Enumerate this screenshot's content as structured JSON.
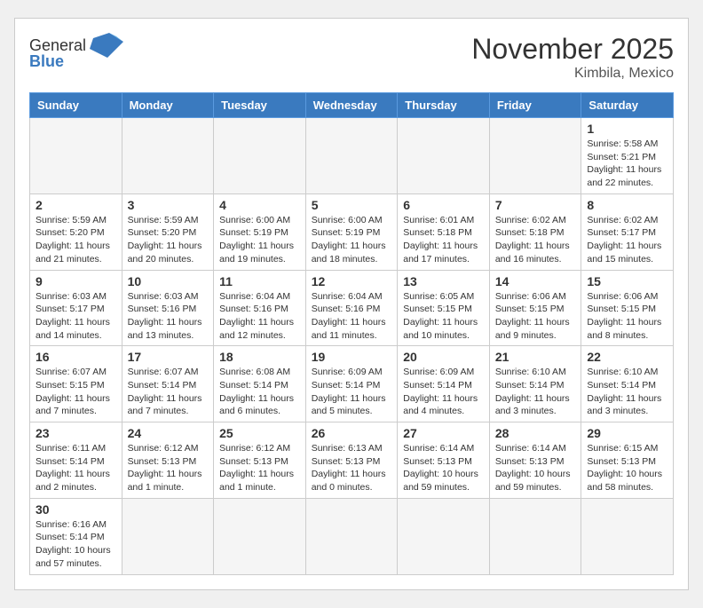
{
  "header": {
    "logo_general": "General",
    "logo_blue": "Blue",
    "title": "November 2025",
    "subtitle": "Kimbila, Mexico"
  },
  "days_of_week": [
    "Sunday",
    "Monday",
    "Tuesday",
    "Wednesday",
    "Thursday",
    "Friday",
    "Saturday"
  ],
  "weeks": [
    [
      {
        "day": "",
        "info": ""
      },
      {
        "day": "",
        "info": ""
      },
      {
        "day": "",
        "info": ""
      },
      {
        "day": "",
        "info": ""
      },
      {
        "day": "",
        "info": ""
      },
      {
        "day": "",
        "info": ""
      },
      {
        "day": "1",
        "info": "Sunrise: 5:58 AM\nSunset: 5:21 PM\nDaylight: 11 hours and 22 minutes."
      }
    ],
    [
      {
        "day": "2",
        "info": "Sunrise: 5:59 AM\nSunset: 5:20 PM\nDaylight: 11 hours and 21 minutes."
      },
      {
        "day": "3",
        "info": "Sunrise: 5:59 AM\nSunset: 5:20 PM\nDaylight: 11 hours and 20 minutes."
      },
      {
        "day": "4",
        "info": "Sunrise: 6:00 AM\nSunset: 5:19 PM\nDaylight: 11 hours and 19 minutes."
      },
      {
        "day": "5",
        "info": "Sunrise: 6:00 AM\nSunset: 5:19 PM\nDaylight: 11 hours and 18 minutes."
      },
      {
        "day": "6",
        "info": "Sunrise: 6:01 AM\nSunset: 5:18 PM\nDaylight: 11 hours and 17 minutes."
      },
      {
        "day": "7",
        "info": "Sunrise: 6:02 AM\nSunset: 5:18 PM\nDaylight: 11 hours and 16 minutes."
      },
      {
        "day": "8",
        "info": "Sunrise: 6:02 AM\nSunset: 5:17 PM\nDaylight: 11 hours and 15 minutes."
      }
    ],
    [
      {
        "day": "9",
        "info": "Sunrise: 6:03 AM\nSunset: 5:17 PM\nDaylight: 11 hours and 14 minutes."
      },
      {
        "day": "10",
        "info": "Sunrise: 6:03 AM\nSunset: 5:16 PM\nDaylight: 11 hours and 13 minutes."
      },
      {
        "day": "11",
        "info": "Sunrise: 6:04 AM\nSunset: 5:16 PM\nDaylight: 11 hours and 12 minutes."
      },
      {
        "day": "12",
        "info": "Sunrise: 6:04 AM\nSunset: 5:16 PM\nDaylight: 11 hours and 11 minutes."
      },
      {
        "day": "13",
        "info": "Sunrise: 6:05 AM\nSunset: 5:15 PM\nDaylight: 11 hours and 10 minutes."
      },
      {
        "day": "14",
        "info": "Sunrise: 6:06 AM\nSunset: 5:15 PM\nDaylight: 11 hours and 9 minutes."
      },
      {
        "day": "15",
        "info": "Sunrise: 6:06 AM\nSunset: 5:15 PM\nDaylight: 11 hours and 8 minutes."
      }
    ],
    [
      {
        "day": "16",
        "info": "Sunrise: 6:07 AM\nSunset: 5:15 PM\nDaylight: 11 hours and 7 minutes."
      },
      {
        "day": "17",
        "info": "Sunrise: 6:07 AM\nSunset: 5:14 PM\nDaylight: 11 hours and 7 minutes."
      },
      {
        "day": "18",
        "info": "Sunrise: 6:08 AM\nSunset: 5:14 PM\nDaylight: 11 hours and 6 minutes."
      },
      {
        "day": "19",
        "info": "Sunrise: 6:09 AM\nSunset: 5:14 PM\nDaylight: 11 hours and 5 minutes."
      },
      {
        "day": "20",
        "info": "Sunrise: 6:09 AM\nSunset: 5:14 PM\nDaylight: 11 hours and 4 minutes."
      },
      {
        "day": "21",
        "info": "Sunrise: 6:10 AM\nSunset: 5:14 PM\nDaylight: 11 hours and 3 minutes."
      },
      {
        "day": "22",
        "info": "Sunrise: 6:10 AM\nSunset: 5:14 PM\nDaylight: 11 hours and 3 minutes."
      }
    ],
    [
      {
        "day": "23",
        "info": "Sunrise: 6:11 AM\nSunset: 5:14 PM\nDaylight: 11 hours and 2 minutes."
      },
      {
        "day": "24",
        "info": "Sunrise: 6:12 AM\nSunset: 5:13 PM\nDaylight: 11 hours and 1 minute."
      },
      {
        "day": "25",
        "info": "Sunrise: 6:12 AM\nSunset: 5:13 PM\nDaylight: 11 hours and 1 minute."
      },
      {
        "day": "26",
        "info": "Sunrise: 6:13 AM\nSunset: 5:13 PM\nDaylight: 11 hours and 0 minutes."
      },
      {
        "day": "27",
        "info": "Sunrise: 6:14 AM\nSunset: 5:13 PM\nDaylight: 10 hours and 59 minutes."
      },
      {
        "day": "28",
        "info": "Sunrise: 6:14 AM\nSunset: 5:13 PM\nDaylight: 10 hours and 59 minutes."
      },
      {
        "day": "29",
        "info": "Sunrise: 6:15 AM\nSunset: 5:13 PM\nDaylight: 10 hours and 58 minutes."
      }
    ],
    [
      {
        "day": "30",
        "info": "Sunrise: 6:16 AM\nSunset: 5:14 PM\nDaylight: 10 hours and 57 minutes."
      },
      {
        "day": "",
        "info": ""
      },
      {
        "day": "",
        "info": ""
      },
      {
        "day": "",
        "info": ""
      },
      {
        "day": "",
        "info": ""
      },
      {
        "day": "",
        "info": ""
      },
      {
        "day": "",
        "info": ""
      }
    ]
  ]
}
